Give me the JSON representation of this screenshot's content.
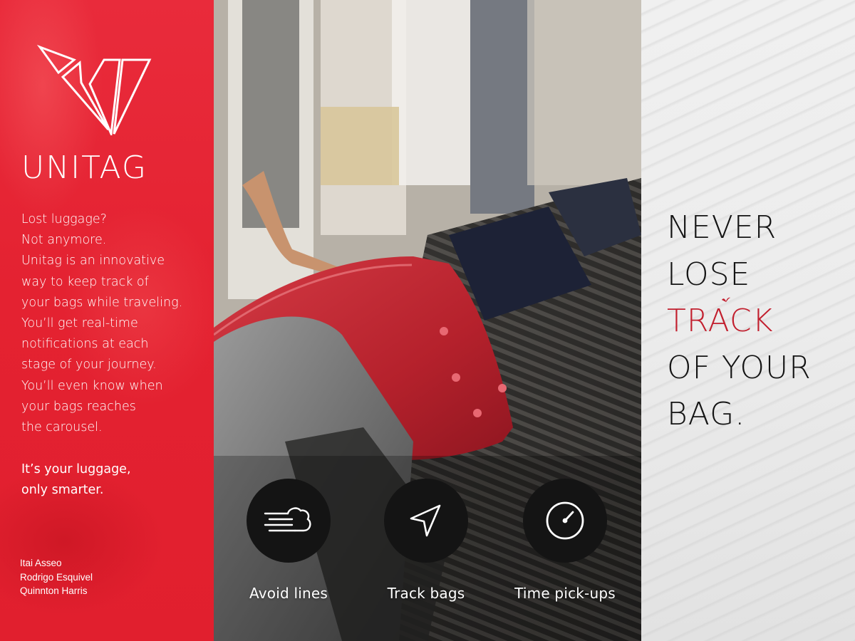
{
  "brand": {
    "name": "UNITAG",
    "accent_color": "#e42231",
    "logo_icon": "unitag-logo-icon"
  },
  "intro": {
    "lines": [
      "Lost luggage?",
      "Not anymore.",
      "Unitag is an innovative",
      "way to keep track of",
      "your bags while traveling.",
      "You’ll get real-time",
      "notifications at each",
      "stage of your journey.",
      "You’ll even know when",
      "your bags reaches",
      "the carousel."
    ],
    "tagline_lines": [
      "It’s your luggage,",
      "only smarter."
    ]
  },
  "credits": [
    "Itai Asseo",
    "Rodrigo Esquivel",
    "Quinnton Harris"
  ],
  "features": [
    {
      "label": "Avoid lines",
      "icon": "wind-cloud-icon"
    },
    {
      "label": "Track bags",
      "icon": "navigation-arrow-icon"
    },
    {
      "label": "Time pick-ups",
      "icon": "gauge-icon"
    }
  ],
  "headline": {
    "line1": "NEVER",
    "line2": "LOSE",
    "line3": "TRACK",
    "line4": "OF YOUR",
    "line5": "BAG.",
    "accent_color": "#c21f2e"
  }
}
